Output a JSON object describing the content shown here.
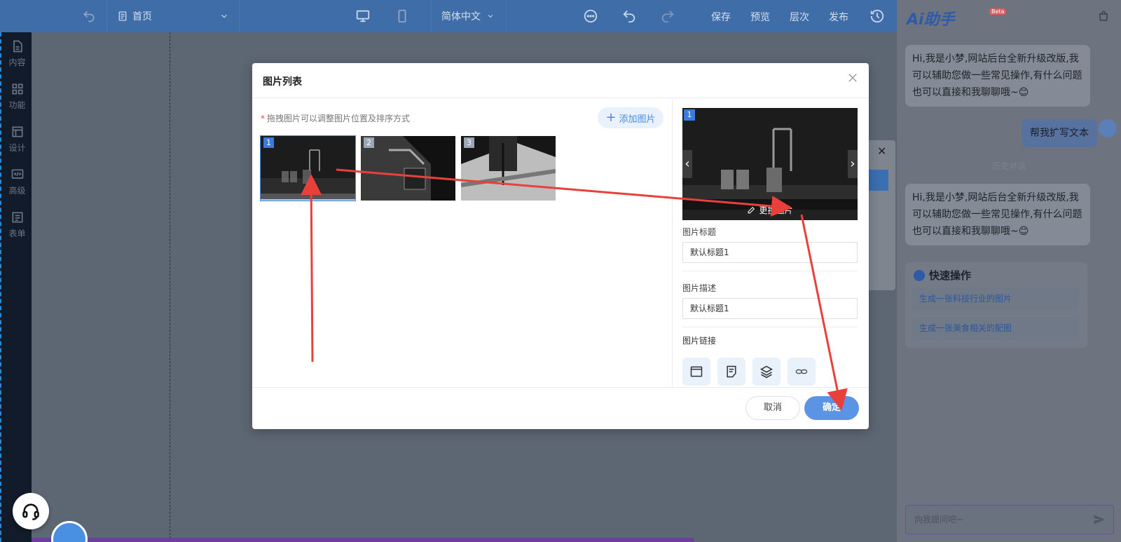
{
  "topbar": {
    "page_name": "首页",
    "language": "简体中文",
    "actions": [
      "保存",
      "预览",
      "层次",
      "发布"
    ]
  },
  "sidebar": {
    "items": [
      {
        "label": "内容",
        "icon": "document-icon"
      },
      {
        "label": "功能",
        "icon": "grid-icon"
      },
      {
        "label": "设计",
        "icon": "layout-icon"
      },
      {
        "label": "高级",
        "icon": "code-icon"
      },
      {
        "label": "表单",
        "icon": "list-icon"
      }
    ]
  },
  "modal": {
    "title": "图片列表",
    "hint": "拖拽图片可以调整图片位置及排序方式",
    "add_image_label": "添加图片",
    "thumbnails": [
      {
        "num": "1",
        "active": true
      },
      {
        "num": "2",
        "active": false
      },
      {
        "num": "3",
        "active": false
      }
    ],
    "preview": {
      "num": "1",
      "replace_label": "更换图片"
    },
    "title_label": "图片标题",
    "title_value": "默认标题1",
    "desc_label": "图片描述",
    "desc_value": "默认标题1",
    "link_label": "图片链接",
    "link_types": [
      "page-link-icon",
      "article-link-icon",
      "layers-icon",
      "url-link-icon"
    ],
    "cancel_label": "取消",
    "confirm_label": "确定"
  },
  "ai_panel": {
    "logo": "Ai助手",
    "beta": "Beta",
    "greeting_1": "Hi,我是小梦,网站后台全新升级改版,我可以辅助您做一些常见操作,有什么问题也可以直接和我聊聊哦~😊",
    "user_message": "帮我扩写文本",
    "history_label": "历史对话",
    "greeting_2": "Hi,我是小梦,网站后台全新升级改版,我可以辅助您做一些常见操作,有什么问题也可以直接和我聊聊哦~😊",
    "quick_title": "快速操作",
    "quick_actions": [
      "生成一张科技行业的图片",
      "生成一张美食相关的配图"
    ],
    "input_placeholder": "向我提问吧~"
  },
  "colors": {
    "accent": "#4a8de0",
    "annotation_arrow": "#e8413c",
    "topbar": "#3f6da8"
  }
}
